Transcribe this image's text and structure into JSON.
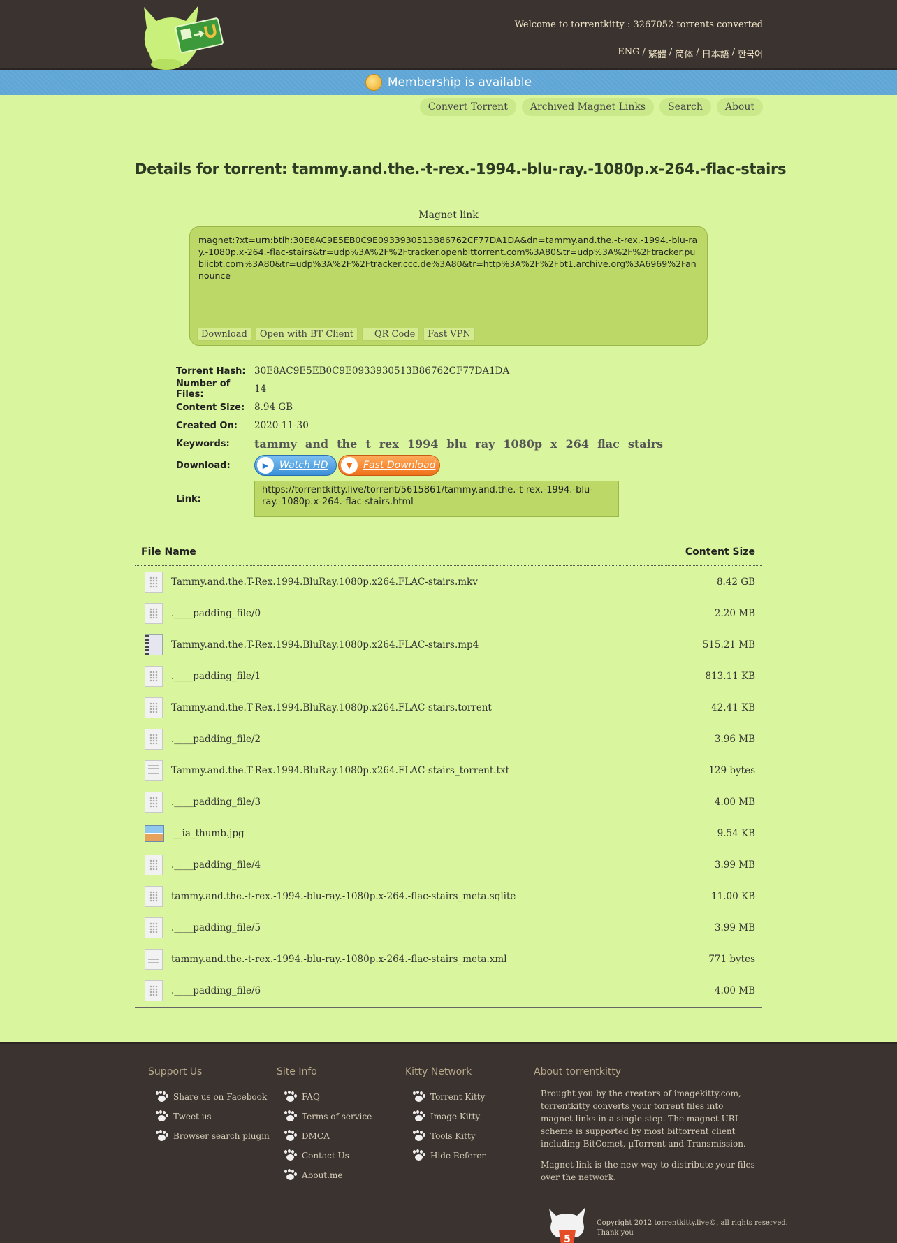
{
  "header": {
    "welcome": "Welcome to torrentkitty : 3267052 torrents converted",
    "languages": [
      "ENG",
      "繁體",
      "简体",
      "日本語",
      "한국어"
    ]
  },
  "banner": {
    "text": "Membership is available"
  },
  "nav": [
    "Convert Torrent",
    "Archived Magnet Links",
    "Search",
    "About"
  ],
  "page_title": "Details for torrent: tammy.and.the.-t-rex.-1994.-blu-ray.-1080p.x-264.-flac-stairs",
  "magnet": {
    "label": "Magnet link",
    "uri": "magnet:?xt=urn:btih:30E8AC9E5EB0C9E0933930513B86762CF77DA1DA&dn=tammy.and.the.-t-rex.-1994.-blu-ray.-1080p.x-264.-flac-stairs&tr=udp%3A%2F%2Ftracker.openbittorrent.com%3A80&tr=udp%3A%2F%2Ftracker.publicbt.com%3A80&tr=udp%3A%2F%2Ftracker.ccc.de%3A80&tr=http%3A%2F%2Fbt1.archive.org%3A6969%2Fannounce",
    "actions": [
      "Download",
      "Open with BT Client",
      "QR Code",
      "Fast VPN"
    ]
  },
  "details": {
    "hash_label": "Torrent Hash:",
    "hash": "30E8AC9E5EB0C9E0933930513B86762CF77DA1DA",
    "files_label": "Number of Files:",
    "files": "14",
    "size_label": "Content Size:",
    "size": "8.94 GB",
    "created_label": "Created On:",
    "created": "2020-11-30",
    "keywords_label": "Keywords:",
    "keywords": [
      "tammy",
      "and",
      "the",
      "t",
      "rex",
      "1994",
      "blu",
      "ray",
      "1080p",
      "x",
      "264",
      "flac",
      "stairs"
    ],
    "download_label": "Download:",
    "watch_hd": "Watch HD",
    "fast_download": "Fast Download",
    "link_label": "Link:",
    "link": "https://torrentkitty.live/torrent/5615861/tammy.and.the.-t-rex.-1994.-blu-ray.-1080p.x-264.-flac-stairs.html"
  },
  "files": {
    "col_name": "File Name",
    "col_size": "Content Size",
    "rows": [
      {
        "icon": "dots",
        "name": "Tammy.and.the.T-Rex.1994.BluRay.1080p.x264.FLAC-stairs.mkv",
        "size": "8.42 GB"
      },
      {
        "icon": "dots",
        "name": ".____padding_file/0",
        "size": "2.20 MB"
      },
      {
        "icon": "video",
        "name": "Tammy.and.the.T-Rex.1994.BluRay.1080p.x264.FLAC-stairs.mp4",
        "size": "515.21 MB"
      },
      {
        "icon": "dots",
        "name": ".____padding_file/1",
        "size": "813.11 KB"
      },
      {
        "icon": "dots",
        "name": "Tammy.and.the.T-Rex.1994.BluRay.1080p.x264.FLAC-stairs.torrent",
        "size": "42.41 KB"
      },
      {
        "icon": "dots",
        "name": ".____padding_file/2",
        "size": "3.96 MB"
      },
      {
        "icon": "doc",
        "name": "Tammy.and.the.T-Rex.1994.BluRay.1080p.x264.FLAC-stairs_torrent.txt",
        "size": "129 bytes"
      },
      {
        "icon": "dots",
        "name": ".____padding_file/3",
        "size": "4.00 MB"
      },
      {
        "icon": "image",
        "name": "__ia_thumb.jpg",
        "size": "9.54 KB"
      },
      {
        "icon": "dots",
        "name": ".____padding_file/4",
        "size": "3.99 MB"
      },
      {
        "icon": "dots",
        "name": "tammy.and.the.-t-rex.-1994.-blu-ray.-1080p.x-264.-flac-stairs_meta.sqlite",
        "size": "11.00 KB"
      },
      {
        "icon": "dots",
        "name": ".____padding_file/5",
        "size": "3.99 MB"
      },
      {
        "icon": "doc",
        "name": "tammy.and.the.-t-rex.-1994.-blu-ray.-1080p.x-264.-flac-stairs_meta.xml",
        "size": "771 bytes"
      },
      {
        "icon": "dots",
        "name": ".____padding_file/6",
        "size": "4.00 MB"
      }
    ]
  },
  "footer": {
    "support": {
      "title": "Support Us",
      "items": [
        "Share us on Facebook",
        "Tweet us",
        "Browser search plugin"
      ]
    },
    "site": {
      "title": "Site Info",
      "items": [
        "FAQ",
        "Terms of service",
        "DMCA",
        "Contact Us",
        "About.me"
      ]
    },
    "network": {
      "title": "Kitty Network",
      "items": [
        "Torrent Kitty",
        "Image Kitty",
        "Tools Kitty",
        "Hide Referer"
      ]
    },
    "about": {
      "title": "About torrentkitty",
      "p1": "Brought you by the creators of imagekitty.com, torrentkitty converts your torrent files into magnet links in a single step. The magnet URI scheme is supported by most bittorrent client including BitComet, µTorrent and Transmission.",
      "p2": "Magnet link is the new way to distribute your files over the network."
    },
    "copyright1": "Copyright 2012 torrentkitty.live©, all rights reserved.",
    "copyright2": "Thank you"
  }
}
